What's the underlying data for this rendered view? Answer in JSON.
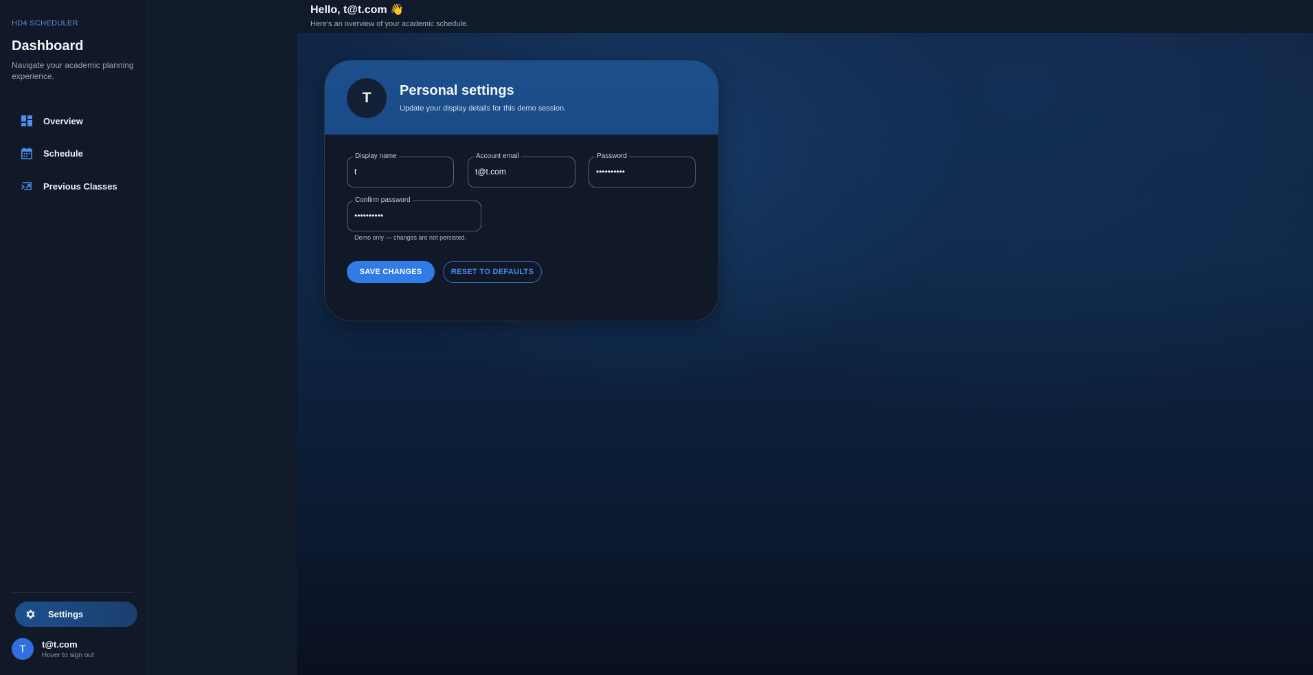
{
  "sidebar": {
    "brand": "HD4 SCHEDULER",
    "title": "Dashboard",
    "subtitle": "Navigate your academic planning experience.",
    "items": [
      {
        "label": "Overview",
        "icon": "dashboard-icon"
      },
      {
        "label": "Schedule",
        "icon": "calendar-icon"
      },
      {
        "label": "Previous Classes",
        "icon": "history-icon"
      }
    ],
    "settings_label": "Settings",
    "user": {
      "initial": "T",
      "name": "t@t.com",
      "hint": "Hover to sign out"
    }
  },
  "header": {
    "greeting": "Hello, t@t.com 👋",
    "subtitle": "Here's an overview of your academic schedule."
  },
  "card": {
    "avatar_initial": "T",
    "title": "Personal settings",
    "subtitle": "Update your display details for this demo session.",
    "fields": {
      "display_name": {
        "label": "Display name",
        "value": "t"
      },
      "account_email": {
        "label": "Account email",
        "value": "t@t.com"
      },
      "password": {
        "label": "Password",
        "value": "••••••••••"
      },
      "confirm_password": {
        "label": "Confirm password",
        "value": "••••••••••"
      }
    },
    "helper": "Demo only — changes are not persisted.",
    "save_label": "SAVE CHANGES",
    "reset_label": "RESET TO DEFAULTS"
  },
  "colors": {
    "accent": "#2f7be8",
    "nav_icon": "#4a8ef0",
    "sidebar_bg": "#111827",
    "card_header": "#1c4f8c"
  }
}
